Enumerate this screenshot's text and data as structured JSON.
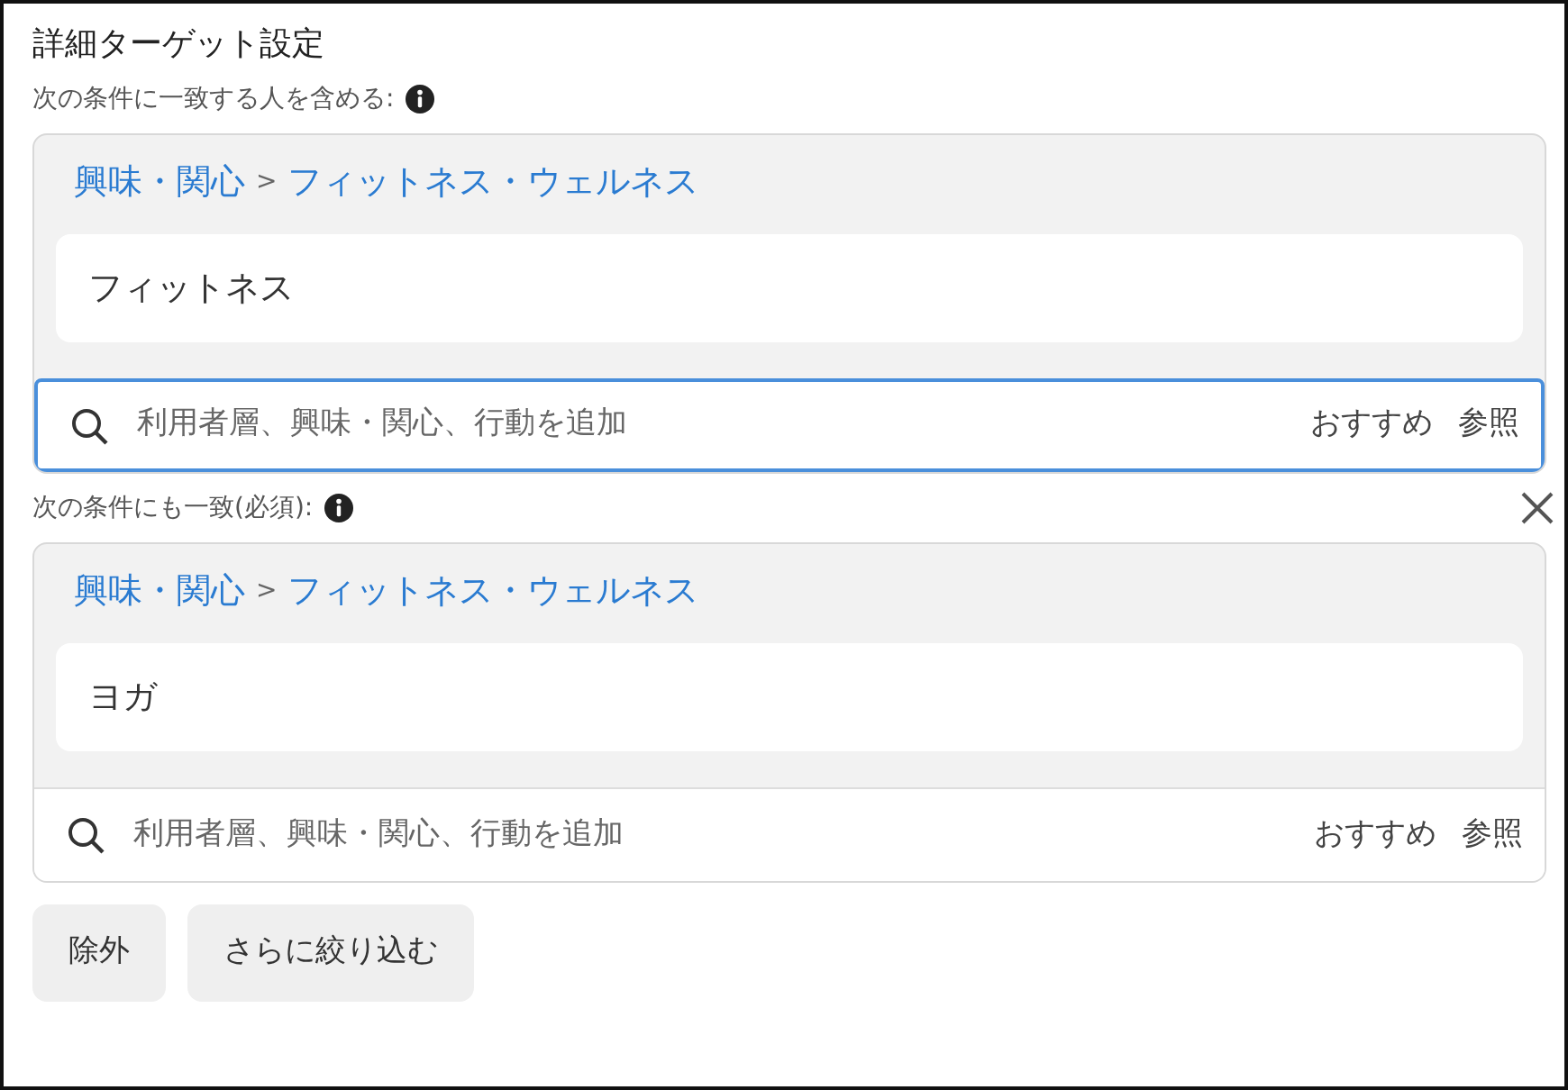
{
  "title": "詳細ターゲット設定",
  "groups": [
    {
      "label": "次の条件に一致する人を含める:",
      "removable": false,
      "breadcrumb": {
        "parent": "興味・関心",
        "separator": ">",
        "child": "フィットネス・ウェルネス"
      },
      "items": [
        "フィットネス"
      ],
      "search": {
        "placeholder": "利用者層、興味・関心、行動を追加",
        "focused": true,
        "actions": [
          "おすすめ",
          "参照"
        ]
      }
    },
    {
      "label": "次の条件にも一致(必須):",
      "removable": true,
      "breadcrumb": {
        "parent": "興味・関心",
        "separator": ">",
        "child": "フィットネス・ウェルネス"
      },
      "items": [
        "ヨガ"
      ],
      "search": {
        "placeholder": "利用者層、興味・関心、行動を追加",
        "focused": false,
        "actions": [
          "おすすめ",
          "参照"
        ]
      }
    }
  ],
  "buttons": [
    "除外",
    "さらに絞り込む"
  ]
}
